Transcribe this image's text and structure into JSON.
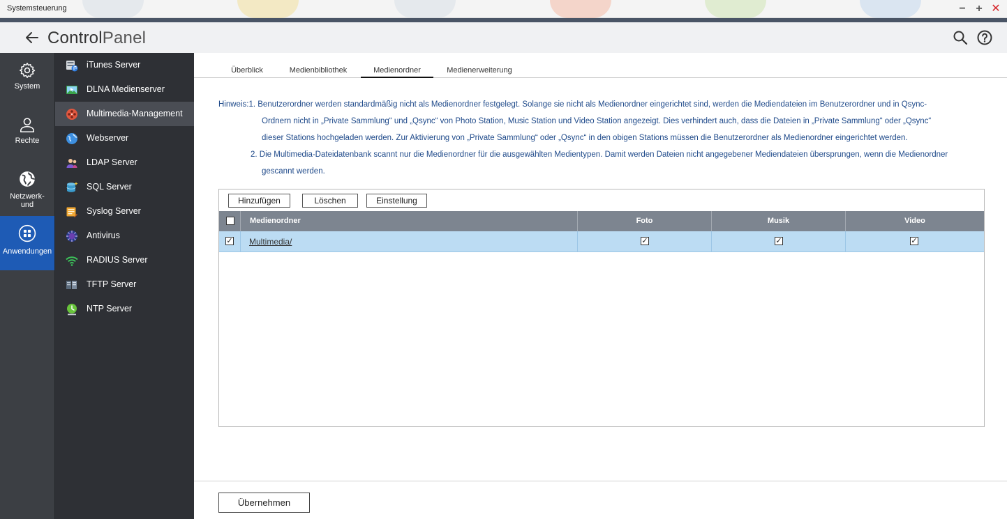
{
  "window": {
    "title": "Systemsteuerung",
    "minimize": "−",
    "maximize": "+",
    "close": "✕"
  },
  "header": {
    "title_bold": "Control",
    "title_light": "Panel",
    "icons": [
      "back-arrow-icon",
      "search-icon",
      "help-icon"
    ]
  },
  "categories": [
    {
      "label": "System",
      "icon": "gear-icon"
    },
    {
      "label": "Rechte",
      "icon": "user-icon"
    },
    {
      "label": "Netzwerk-\nund",
      "label_line1": "Netzwerk-",
      "label_line2": "und",
      "icon": "globe-icon"
    },
    {
      "label": "Anwendungen",
      "icon": "apps-grid-icon",
      "active": true
    }
  ],
  "submenu": [
    {
      "label": "iTunes Server",
      "icon": "itunes-server-icon"
    },
    {
      "label": "DLNA Medienserver",
      "icon": "dlna-icon"
    },
    {
      "label": "Multimedia-Management",
      "icon": "film-reel-icon",
      "active": true
    },
    {
      "label": "Webserver",
      "icon": "web-globe-icon"
    },
    {
      "label": "LDAP Server",
      "icon": "ldap-users-icon"
    },
    {
      "label": "SQL Server",
      "icon": "database-icon"
    },
    {
      "label": "Syslog Server",
      "icon": "syslog-icon"
    },
    {
      "label": "Antivirus",
      "icon": "antivirus-icon"
    },
    {
      "label": "RADIUS Server",
      "icon": "wifi-icon"
    },
    {
      "label": "TFTP Server",
      "icon": "tftp-server-icon"
    },
    {
      "label": "NTP Server",
      "icon": "clock-icon"
    }
  ],
  "tabs": [
    {
      "label": "Überblick"
    },
    {
      "label": "Medienbibliothek"
    },
    {
      "label": "Medienordner",
      "active": true
    },
    {
      "label": "Medienerweiterung"
    }
  ],
  "notice": {
    "prefix": "Hinweis:",
    "line1": "1. Benutzerordner werden standardmäßig nicht als Medienordner festgelegt. Solange sie nicht als Medienordner eingerichtet sind, werden die Mediendateien im Benutzerordner und in Qsync-",
    "line2": "Ordnern nicht in „Private Sammlung“ und „Qsync“ von Photo Station, Music Station und Video Station angezeigt. Dies verhindert auch, dass die Dateien in „Private Sammlung“ oder „Qsync“",
    "line3": "dieser Stations hochgeladen werden. Zur Aktivierung von „Private Sammlung“ oder „Qsync“ in den obigen Stations müssen die Benutzerordner als Medienordner eingerichtet werden.",
    "line4": "2. Die Multimedia-Dateidatenbank scannt nur die Medienordner für die ausgewählten Medientypen. Damit werden Dateien nicht angegebener Mediendateien übersprungen, wenn die Medienordner",
    "line5": "gescannt werden."
  },
  "toolbar": {
    "add": "Hinzufügen",
    "delete": "Löschen",
    "settings": "Einstellung"
  },
  "table": {
    "columns": [
      "Medienordner",
      "Foto",
      "Musik",
      "Video"
    ],
    "rows": [
      {
        "folder": "Multimedia/",
        "selected": true,
        "foto": true,
        "musik": true,
        "video": true
      }
    ]
  },
  "footer": {
    "apply": "Übernehmen"
  },
  "colors": {
    "accent": "#1e5bb5",
    "sidebar": "#3c3f44",
    "submenu": "#2e3035",
    "table_header": "#7d8590",
    "row_selected": "#bcdcf3",
    "notice_text": "#1f4a8a"
  }
}
